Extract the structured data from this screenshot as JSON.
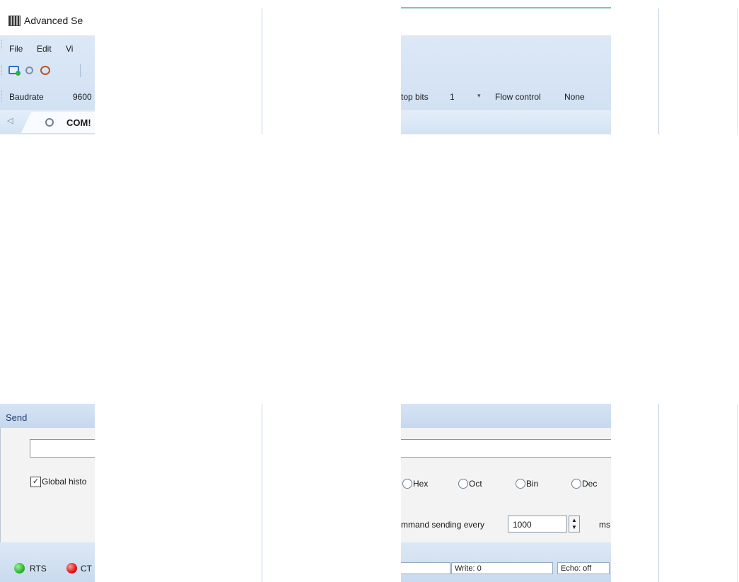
{
  "window": {
    "title": "Advanced Se"
  },
  "menu": {
    "items": [
      "File",
      "Edit",
      "Vi"
    ]
  },
  "toolbar": {
    "icons": [
      "new-port-icon",
      "find-port-icon",
      "port-monitor-icon"
    ],
    "baudrate_label": "Baudrate",
    "baudrate_value": "9600",
    "stop_bits_label": "top bits",
    "stop_bits_value": "1",
    "flow_control_label": "Flow control",
    "flow_control_value": "None"
  },
  "tabs": {
    "active": "COM!"
  },
  "send": {
    "header": "Send",
    "global_history_label": "Global histo",
    "global_history_checked": true,
    "formats": [
      "Hex",
      "Oct",
      "Bin",
      "Dec"
    ],
    "repeat_label": "mmand sending every",
    "repeat_value": "1000",
    "repeat_unit": "ms"
  },
  "status": {
    "signals": [
      {
        "label": "RTS",
        "color": "#2fb52f"
      },
      {
        "label": "CT",
        "color": "#e01515"
      }
    ],
    "write": "Write: 0",
    "echo": "Echo: off"
  },
  "colors": {
    "accent": "#cfdff2",
    "border": "#9fb4cf"
  }
}
